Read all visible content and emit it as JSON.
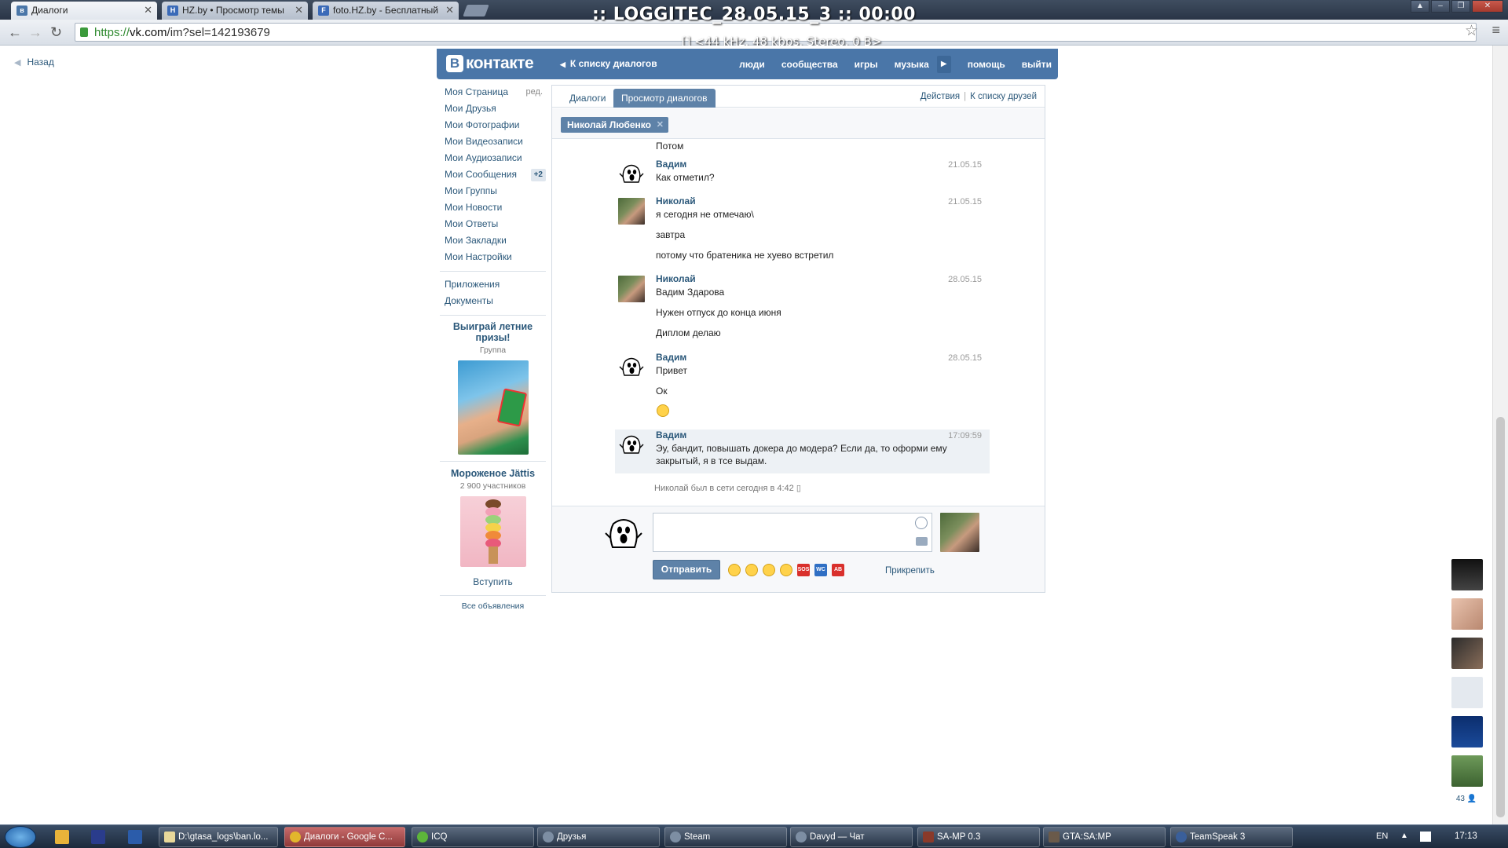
{
  "browser": {
    "tabs": [
      {
        "title": "Диалоги",
        "active": true
      },
      {
        "title": "HZ.by • Просмотр темы"
      },
      {
        "title": "foto.HZ.by - Бесплатный"
      }
    ],
    "url_scheme": "https://",
    "url_domain": "vk.com",
    "url_path": "/im?sel=142193679"
  },
  "overlay": {
    "title": ":: LOGGITEC_28.05.15_3 :: 00:00",
    "subtitle": "[] <44 kHz, 48 kbps, Stereo, 0 B>"
  },
  "page": {
    "back_label": "Назад"
  },
  "header": {
    "logo_letter": "В",
    "logo_text": "контакте",
    "back_to_dialogs": "К списку диалогов",
    "nav": [
      "люди",
      "сообщества",
      "игры",
      "музыка",
      "помощь",
      "выйти"
    ]
  },
  "left_nav": {
    "items": [
      {
        "label": "Моя Страница",
        "extra": "ред."
      },
      {
        "label": "Мои Друзья"
      },
      {
        "label": "Мои Фотографии"
      },
      {
        "label": "Мои Видеозаписи"
      },
      {
        "label": "Мои Аудиозаписи"
      },
      {
        "label": "Мои Сообщения",
        "badge": "+2"
      },
      {
        "label": "Мои Группы"
      },
      {
        "label": "Мои Новости"
      },
      {
        "label": "Мои Ответы"
      },
      {
        "label": "Мои Закладки"
      },
      {
        "label": "Мои Настройки"
      }
    ],
    "extra_items": [
      "Приложения",
      "Документы"
    ]
  },
  "ads": {
    "ad1_title": "Выиграй летние призы!",
    "ad1_sub": "Группа",
    "ad2_title": "Мороженое Jättis",
    "ad2_sub": "2 900 участников",
    "ad2_join": "Вступить",
    "all_ads": "Все объявления"
  },
  "dialog": {
    "tabs": [
      "Диалоги",
      "Просмотр диалогов"
    ],
    "actions": "Действия",
    "friends_link": "К списку друзей",
    "peer_name": "Николай Любенко",
    "messages": [
      {
        "text": "Потом"
      },
      {
        "author": "Вадим",
        "date": "21.05.15",
        "text": "Как отметил?"
      },
      {
        "author": "Николай",
        "date": "21.05.15",
        "text": "я сегодня не отмечаю\\"
      },
      {
        "text": "завтра"
      },
      {
        "text": "потому что братеника не хуево встретил"
      },
      {
        "author": "Николай",
        "date": "28.05.15",
        "text": "Вадим Здарова"
      },
      {
        "text": "Нужен отпуск до конца июня"
      },
      {
        "text": "Диплом делаю"
      },
      {
        "author": "Вадим",
        "date": "28.05.15",
        "text": "Привет"
      },
      {
        "text": "Ок"
      },
      {
        "author": "Вадим",
        "date": "17:09:59",
        "text": "Эу, бандит, повышать докера до модера? Если да, то оформи ему",
        "text2": "закрытый, я в тсе выдам."
      }
    ],
    "online_note": "Николай был в сети сегодня в 4:42",
    "send_label": "Отправить",
    "attach_label": "Прикрепить",
    "emoji_labels": [
      "SOS",
      "WC",
      "AB"
    ]
  },
  "friends_count": "43",
  "taskbar": {
    "tasks": [
      "D:\\gtasa_logs\\ban.lo...",
      "Диалоги - Google C...",
      "ICQ",
      "Друзья",
      "Steam",
      "Davyd — Чат",
      "SA-MP 0.3",
      "GTA:SA:MP",
      "TeamSpeak 3"
    ],
    "lang": "EN",
    "clock": "17:13"
  }
}
